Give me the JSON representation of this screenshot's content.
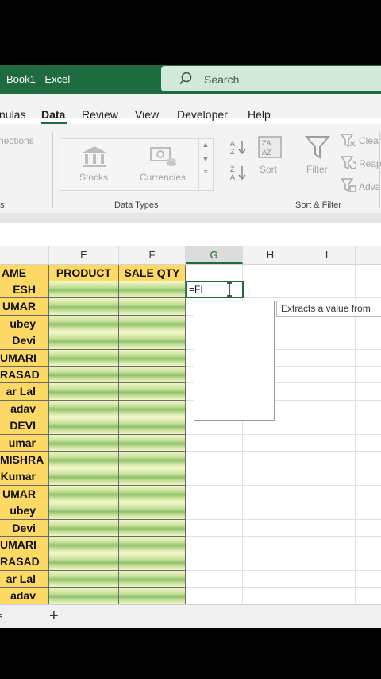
{
  "title_bar": {
    "app_title": "Book1  -  Excel",
    "search_label": "Search"
  },
  "ribbon_tabs": [
    "nulas",
    "Data",
    "Review",
    "View",
    "Developer",
    "Help"
  ],
  "ribbon": {
    "connections_label": "nections",
    "left_group_label": "s",
    "data_types": {
      "stocks": "Stocks",
      "currencies": "Currencies",
      "group_label": "Data Types"
    },
    "sort_filter": {
      "sort": "Sort",
      "filter": "Filter",
      "clear": "Clear",
      "reapply": "Reap",
      "advanced": "Adva",
      "group_label": "Sort & Filter"
    }
  },
  "grid": {
    "columns": [
      "E",
      "F",
      "G",
      "H",
      "I"
    ],
    "headers": {
      "name": "AME",
      "product": "PRODUCT",
      "sale_qty": "SALE QTY"
    },
    "names": [
      "ESH",
      "UMAR",
      "ubey",
      "Devi",
      "UMARI",
      "RASAD",
      "ar Lal",
      "adav",
      "DEVI",
      "umar",
      "MISHRA",
      "Kumar",
      "UMAR",
      "ubey",
      "Devi",
      "UMARI",
      "RASAD",
      "ar Lal",
      "adav"
    ],
    "active_cell_formula": "=FI",
    "tooltip": "Extracts a value from"
  },
  "sheet_tabs": {
    "left_label": "s",
    "add_sheet": "+"
  }
}
